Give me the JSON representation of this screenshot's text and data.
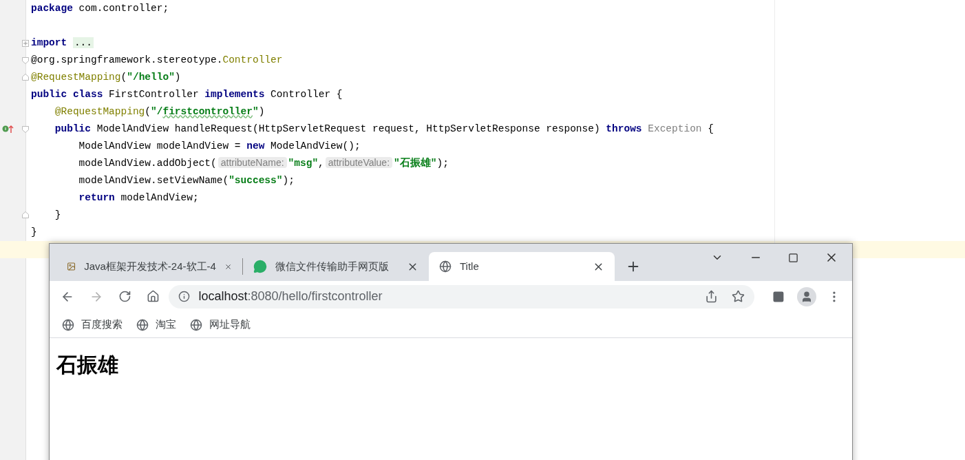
{
  "editor": {
    "lines": [
      {
        "current": false,
        "tokens": [
          {
            "kind": "kw",
            "text": "package"
          },
          {
            "kind": "plain",
            "text": " com.controller;"
          }
        ]
      },
      {
        "current": false
      },
      {
        "kind": "expand",
        "current": false,
        "tokens": [
          {
            "kind": "kw",
            "text": "import"
          },
          {
            "kind": "folded",
            "text": "...",
            "gap": true
          }
        ]
      },
      {
        "kind": "fold-start",
        "current": false,
        "tokens": [
          {
            "kind": "plain",
            "text": "@org.springframework.stereotype."
          },
          {
            "kind": "ann",
            "text": "Controller"
          }
        ]
      },
      {
        "kind": "fold-end",
        "current": false,
        "tokens": [
          {
            "kind": "ann",
            "text": "@RequestMapping"
          },
          {
            "kind": "plain",
            "text": "("
          },
          {
            "kind": "str",
            "text": "\"/hello\""
          },
          {
            "kind": "plain",
            "text": ")"
          }
        ]
      },
      {
        "current": false,
        "tokens": [
          {
            "kind": "kw",
            "text": "public class"
          },
          {
            "kind": "plain",
            "text": " FirstController "
          },
          {
            "kind": "kw",
            "text": "implements"
          },
          {
            "kind": "plain",
            "text": " Controller {"
          }
        ],
        "children": [
          {
            "current": false,
            "tokens": [
              {
                "kind": "ann",
                "text": "@RequestMapping"
              },
              {
                "kind": "plain",
                "text": "("
              },
              {
                "kind": "str",
                "text": "\"/"
              },
              {
                "kind": "str-typo",
                "text": "firstcontroller"
              },
              {
                "kind": "str",
                "text": "\""
              },
              {
                "kind": "plain",
                "text": ")"
              }
            ]
          },
          {
            "kind": "implements",
            "current": false,
            "tokens": [
              {
                "kind": "kw",
                "text": "public"
              },
              {
                "kind": "plain",
                "text": " ModelAndView handleRequest(HttpServletRequest request, HttpServletResponse response) "
              },
              {
                "kind": "kw",
                "text": "throws"
              },
              {
                "kind": "dim",
                "text": "Exception",
                "gap": true
              },
              {
                "kind": "plain",
                "text": " {"
              }
            ],
            "children": [
              {
                "current": false,
                "tokens": [
                  {
                    "kind": "plain",
                    "text": "ModelAndView modelAndView = "
                  },
                  {
                    "kind": "kw",
                    "text": "new"
                  },
                  {
                    "kind": "plain",
                    "text": " ModelAndView();"
                  }
                ]
              },
              {
                "current": false,
                "tokens": [
                  {
                    "kind": "plain",
                    "text": "modelAndView.addObject("
                  },
                  {
                    "kind": "hint",
                    "text": "attributeName:"
                  },
                  {
                    "kind": "str",
                    "text": "\"msg\""
                  },
                  {
                    "kind": "plain",
                    "text": ","
                  },
                  {
                    "kind": "hint",
                    "text": "attributeValue:"
                  },
                  {
                    "kind": "str",
                    "text": "\"石振雄\""
                  },
                  {
                    "kind": "plain",
                    "text": ");"
                  }
                ]
              },
              {
                "current": false,
                "tokens": [
                  {
                    "kind": "plain",
                    "text": "modelAndView.setViewName("
                  },
                  {
                    "kind": "str",
                    "text": "\"success\""
                  },
                  {
                    "kind": "plain",
                    "text": ");"
                  }
                ]
              },
              {
                "current": false,
                "tokens": [
                  {
                    "kind": "kw",
                    "text": "return"
                  },
                  {
                    "kind": "plain",
                    "text": " modelAndView;"
                  }
                ]
              }
            ]
          },
          {
            "kind": "fold-end",
            "current": false,
            "tokens": [
              {
                "kind": "plain",
                "text": "}"
              }
            ]
          }
        ]
      },
      {
        "current": false,
        "tokens": [
          {
            "kind": "plain",
            "text": "}"
          }
        ]
      },
      {
        "current": true
      }
    ]
  },
  "browser": {
    "tabs": [
      {
        "title": "Java框架开发技术-24-软工-4",
        "selected": false
      },
      {
        "title": "微信文件传输助手网页版",
        "selected": false
      },
      {
        "title": "Title",
        "selected": true
      }
    ],
    "url": {
      "host": "localhost",
      "path": ":8080/hello/firstcontroller"
    },
    "bookmarks": [
      "百度搜索",
      "淘宝",
      "网址导航"
    ],
    "page": {
      "heading": "石振雄"
    }
  }
}
